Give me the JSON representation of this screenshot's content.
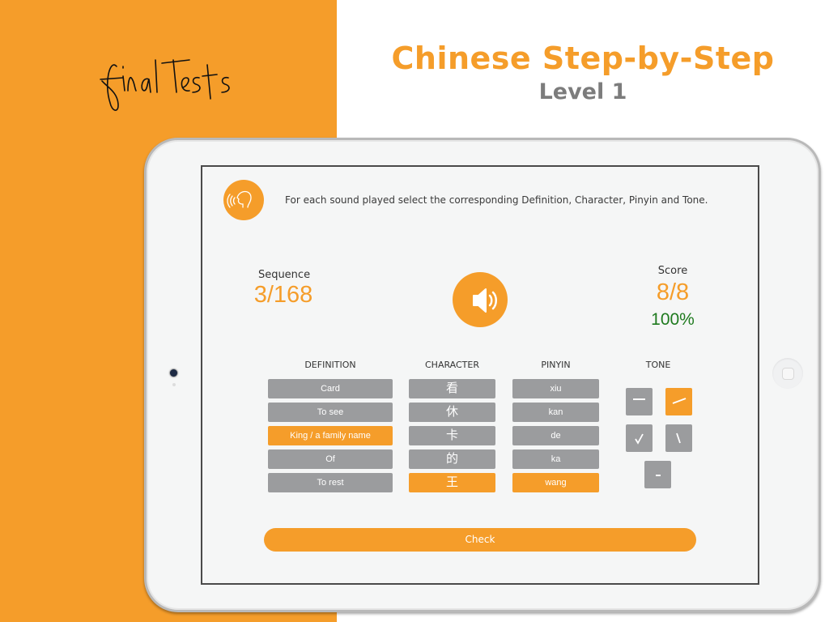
{
  "branding": {
    "script_title": "final Tests",
    "app_title": "Chinese Step-by-Step",
    "level": "Level 1",
    "accent_color": "#f59d2a"
  },
  "quiz": {
    "instructions": "For each sound played select the corresponding Definition, Character, Pinyin and Tone.",
    "sequence_label": "Sequence",
    "sequence_value": "3/168",
    "score_label": "Score",
    "score_value": "8/8",
    "score_percent": "100%",
    "columns": {
      "definition": {
        "header": "DEFINITION",
        "options": [
          "Card",
          "To see",
          "King / a family name",
          "Of",
          "To rest"
        ],
        "selected": 2
      },
      "character": {
        "header": "CHARACTER",
        "options": [
          "看",
          "休",
          "卡",
          "的",
          "王"
        ],
        "selected": 4
      },
      "pinyin": {
        "header": "PINYIN",
        "options": [
          "xiu",
          "kan",
          "de",
          "ka",
          "wang"
        ],
        "selected": 4
      },
      "tone": {
        "header": "TONE",
        "options": [
          "first-tone",
          "second-tone",
          "third-tone",
          "fourth-tone",
          "neutral-tone"
        ],
        "glyphs": [
          "—",
          "╱",
          "√",
          "\\",
          "–"
        ],
        "selected": 1
      }
    },
    "check_label": "Check"
  }
}
